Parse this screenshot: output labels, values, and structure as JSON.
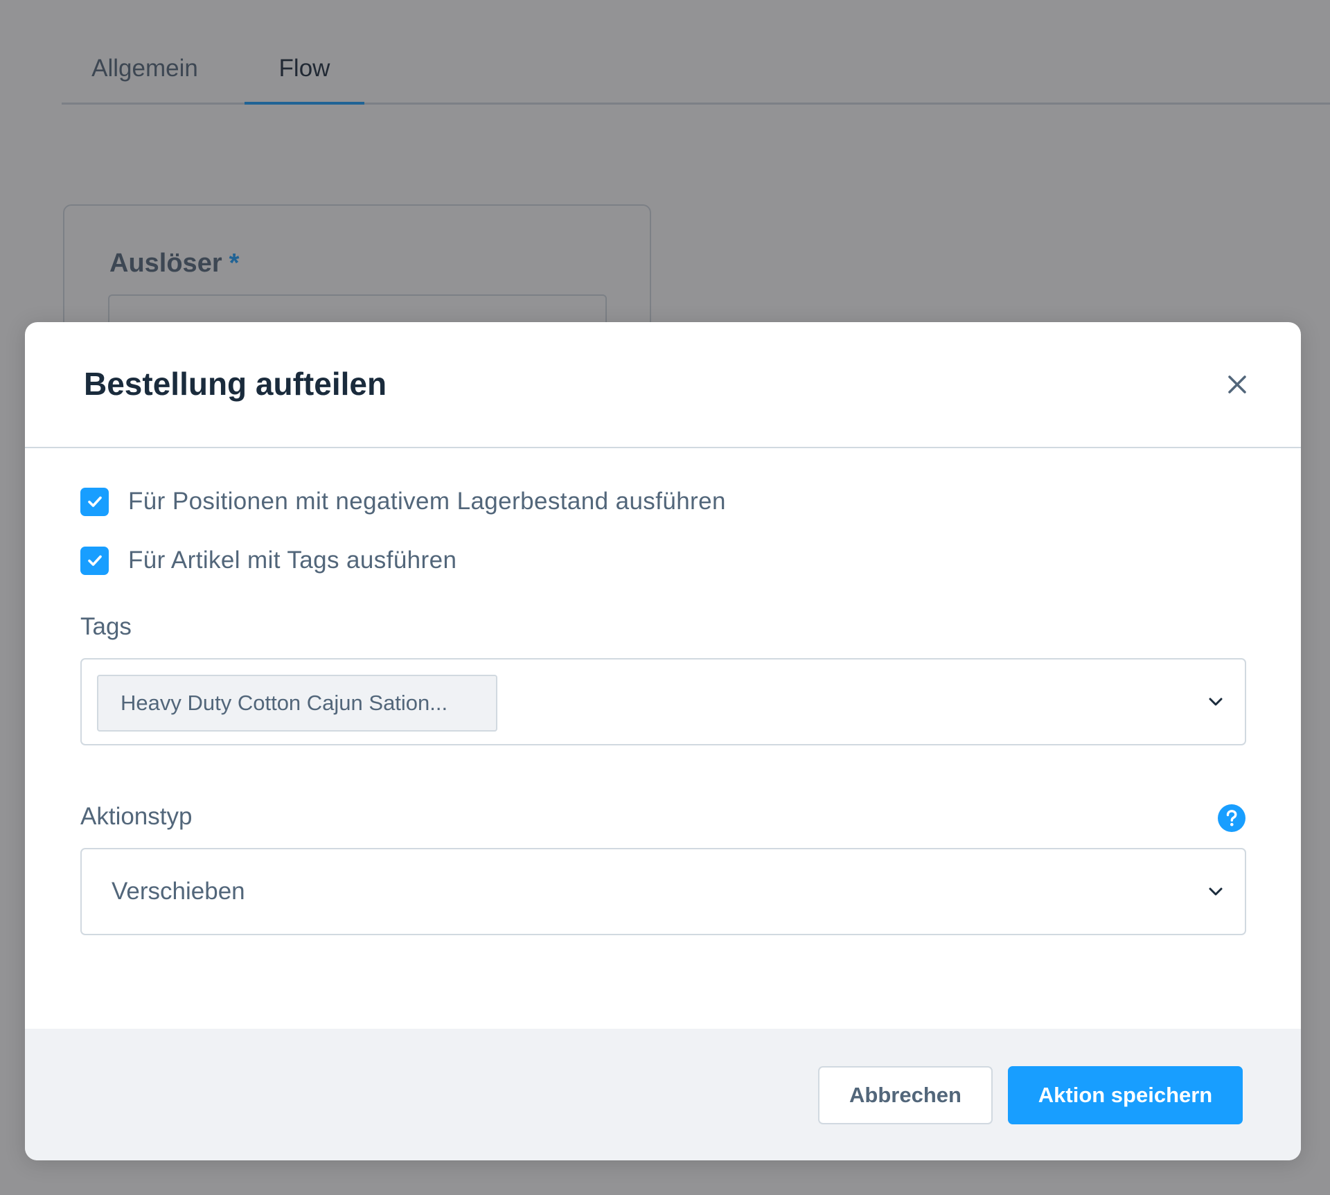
{
  "tabs": [
    {
      "label": "Allgemein"
    },
    {
      "label": "Flow",
      "active": true
    }
  ],
  "card": {
    "label": "Auslöser",
    "required_marker": "*"
  },
  "modal": {
    "title": "Bestellung aufteilen",
    "close_icon": "close-icon",
    "checkboxes": [
      {
        "label": "Für Positionen mit negativem Lagerbestand ausführen",
        "checked": true
      },
      {
        "label": "Für Artikel mit Tags ausführen",
        "checked": true
      }
    ],
    "tags": {
      "label": "Tags",
      "selected_tag": "Heavy Duty Cotton Cajun Sation..."
    },
    "action_type": {
      "label": "Aktionstyp",
      "value": "Verschieben",
      "help_icon": "help-icon"
    },
    "footer": {
      "cancel_label": "Abbrechen",
      "save_label": "Aktion speichern"
    }
  },
  "colors": {
    "accent": "#189eff",
    "text": "#52667a",
    "title": "#1a2b3c",
    "border": "#d1d9e0",
    "footer_bg": "#f0f2f5"
  }
}
